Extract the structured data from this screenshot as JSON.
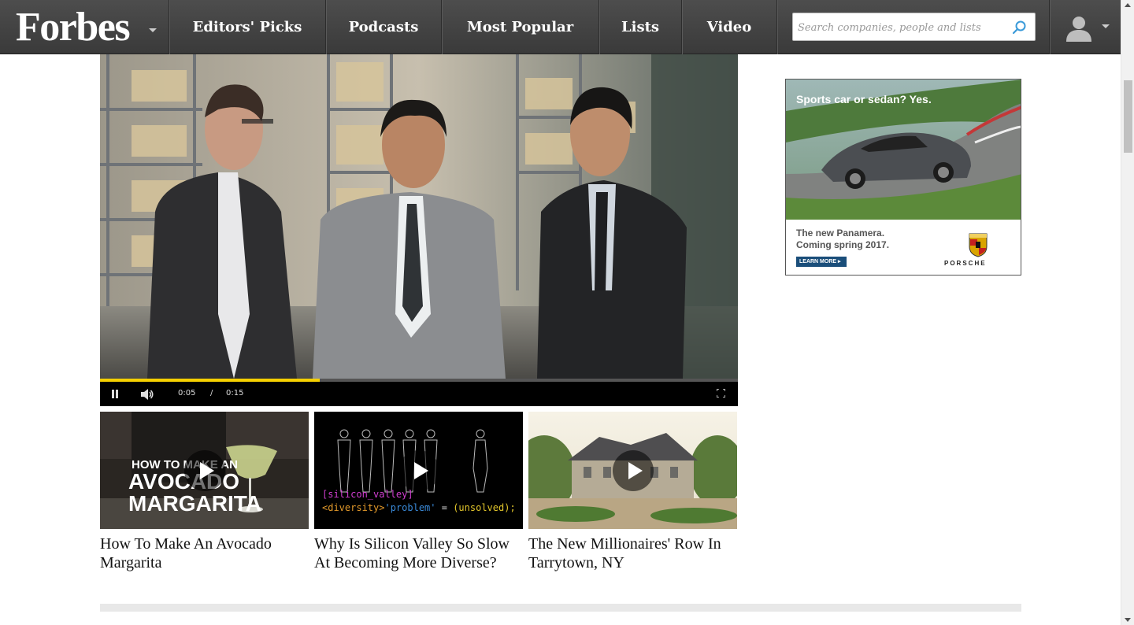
{
  "brand": {
    "logo": "Forbes"
  },
  "nav": {
    "items": [
      {
        "label": "Editors' Picks"
      },
      {
        "label": "Podcasts"
      },
      {
        "label": "Most Popular"
      },
      {
        "label": "Lists"
      },
      {
        "label": "Video"
      }
    ],
    "search_placeholder": "Search companies, people and lists",
    "search_icon": "search-icon",
    "account_icon": "user-avatar-icon"
  },
  "player": {
    "current_time": "0:05",
    "separator": "/",
    "duration": "0:15",
    "progress": 0.345,
    "accent_color": "#f5d000",
    "state": "playing"
  },
  "related_videos": [
    {
      "title": "How To Make An Avocado Margarita",
      "overlay": [
        "HOW TO MAKE AN",
        "AVOCADO",
        "MARGARITA"
      ]
    },
    {
      "title": "Why Is Silicon Valley So Slow At Becoming More Diverse?",
      "code_line1": "[silicon_valley]",
      "code_line2_a": "<diversity>",
      "code_line2_b": "'problem'",
      "code_line2_c": " = ",
      "code_line2_d": "(unsolved);"
    },
    {
      "title": "The New Millionaires' Row In Tarrytown, NY"
    }
  ],
  "ad": {
    "headline": "Sports car or sedan?  Yes.",
    "copy_line1": "The new Panamera.",
    "copy_line2": "Coming spring 2017.",
    "cta": "LEARN MORE ▸",
    "brand": "PORSCHE"
  }
}
